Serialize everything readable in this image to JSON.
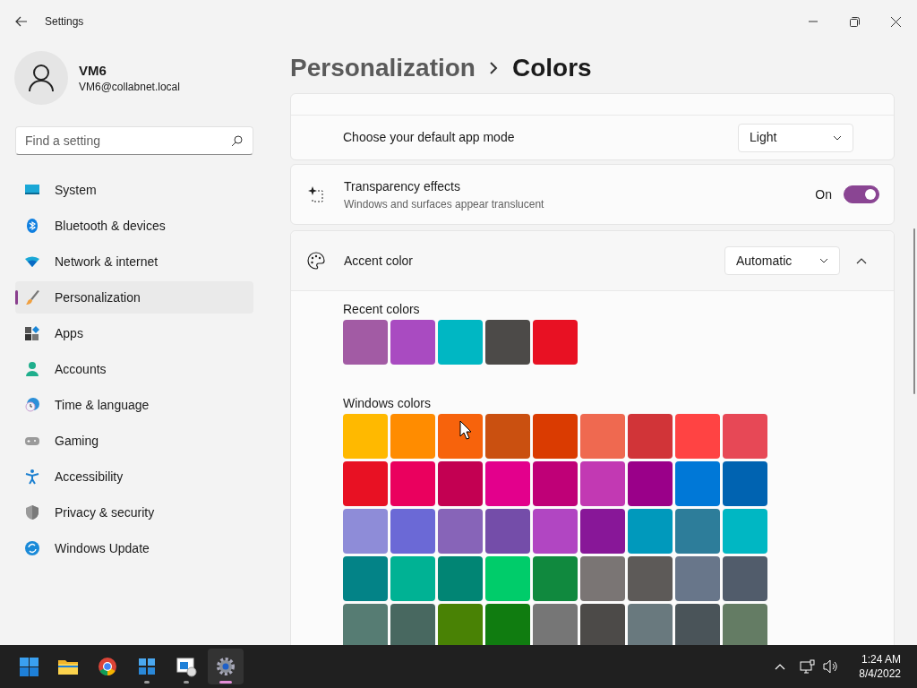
{
  "window": {
    "title": "Settings"
  },
  "user": {
    "name": "VM6",
    "email": "VM6@collabnet.local"
  },
  "search": {
    "placeholder": "Find a setting"
  },
  "nav": [
    {
      "label": "System",
      "selected": false
    },
    {
      "label": "Bluetooth & devices",
      "selected": false
    },
    {
      "label": "Network & internet",
      "selected": false
    },
    {
      "label": "Personalization",
      "selected": true
    },
    {
      "label": "Apps",
      "selected": false
    },
    {
      "label": "Accounts",
      "selected": false
    },
    {
      "label": "Time & language",
      "selected": false
    },
    {
      "label": "Gaming",
      "selected": false
    },
    {
      "label": "Accessibility",
      "selected": false
    },
    {
      "label": "Privacy & security",
      "selected": false
    },
    {
      "label": "Windows Update",
      "selected": false
    }
  ],
  "breadcrumb": {
    "parent": "Personalization",
    "current": "Colors"
  },
  "app_mode": {
    "label": "Choose your default app mode",
    "value": "Light"
  },
  "transparency": {
    "title": "Transparency effects",
    "description": "Windows and surfaces appear translucent",
    "state_label": "On",
    "on": true
  },
  "accent": {
    "label": "Accent color",
    "value": "Automatic",
    "expanded": true,
    "recent_label": "Recent colors",
    "recent": [
      {
        "color": "#a25ba4"
      },
      {
        "color": "#a94bc1"
      },
      {
        "color": "#00b7c3"
      },
      {
        "color": "#4c4a48"
      },
      {
        "color": "#e81123"
      }
    ],
    "windows_label": "Windows colors",
    "windows": [
      {
        "color": "#ffb900"
      },
      {
        "color": "#ff8c00"
      },
      {
        "color": "#f7630c"
      },
      {
        "color": "#ca5010"
      },
      {
        "color": "#da3b01"
      },
      {
        "color": "#ef6950"
      },
      {
        "color": "#d13438"
      },
      {
        "color": "#ff4343"
      },
      {
        "color": "#e74856"
      },
      {
        "color": "#e81123"
      },
      {
        "color": "#ea005e"
      },
      {
        "color": "#c30052"
      },
      {
        "color": "#e3008c"
      },
      {
        "color": "#bf0077"
      },
      {
        "color": "#c239b3"
      },
      {
        "color": "#9a0089"
      },
      {
        "color": "#0078d7"
      },
      {
        "color": "#0063b1"
      },
      {
        "color": "#8e8cd8"
      },
      {
        "color": "#6b69d6"
      },
      {
        "color": "#8764b8"
      },
      {
        "color": "#744da9"
      },
      {
        "color": "#b146c2"
      },
      {
        "color": "#881798"
      },
      {
        "color": "#0099bc"
      },
      {
        "color": "#2d7d9a"
      },
      {
        "color": "#00b7c3"
      },
      {
        "color": "#038387"
      },
      {
        "color": "#00b294"
      },
      {
        "color": "#018574"
      },
      {
        "color": "#00cc6a"
      },
      {
        "color": "#10893e"
      },
      {
        "color": "#7a7574"
      },
      {
        "color": "#5d5a58"
      },
      {
        "color": "#68768a"
      },
      {
        "color": "#515c6b"
      },
      {
        "color": "#567c73"
      },
      {
        "color": "#486860"
      },
      {
        "color": "#498205"
      },
      {
        "color": "#107c10"
      },
      {
        "color": "#767676"
      },
      {
        "color": "#4c4a48"
      },
      {
        "color": "#69797e"
      },
      {
        "color": "#4a5459"
      },
      {
        "color": "#647c64"
      }
    ]
  },
  "taskbar": {
    "apps": [
      {
        "running": false,
        "selected": false
      },
      {
        "running": false,
        "selected": false
      },
      {
        "running": false,
        "selected": false
      },
      {
        "running": true,
        "selected": false
      },
      {
        "running": true,
        "selected": false
      },
      {
        "running": true,
        "selected": true
      }
    ],
    "time": "1:24 AM",
    "date": "8/4/2022"
  }
}
